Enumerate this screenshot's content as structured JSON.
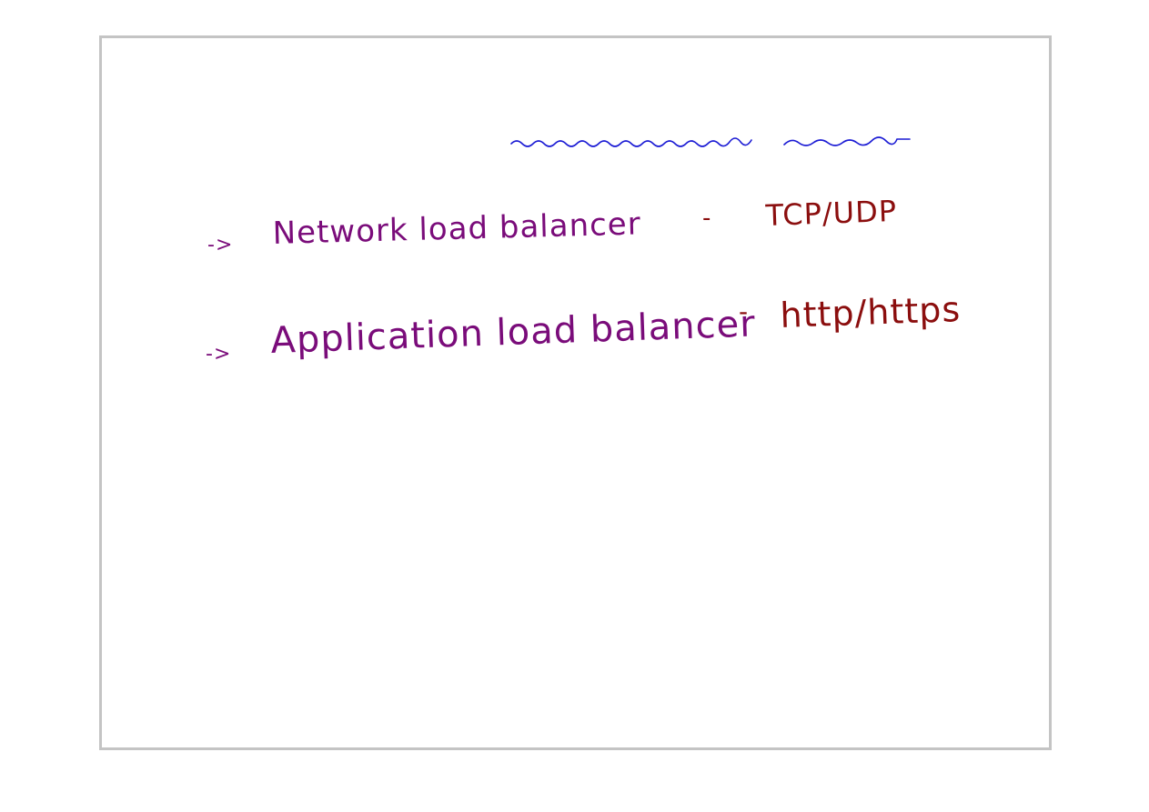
{
  "whiteboard": {
    "ink_colors": {
      "blue": "#1a1ad4",
      "purple": "#7a0c7a",
      "dark_red": "#8b0e0e",
      "frame_border": "#c4c4c4"
    },
    "lines": [
      {
        "bullet": "->",
        "label": "Network load balancer",
        "dash": "-",
        "protocol": "TCP/UDP"
      },
      {
        "bullet": "->",
        "label": "Application load balancer",
        "dash": "-",
        "protocol": "http/https"
      }
    ]
  }
}
